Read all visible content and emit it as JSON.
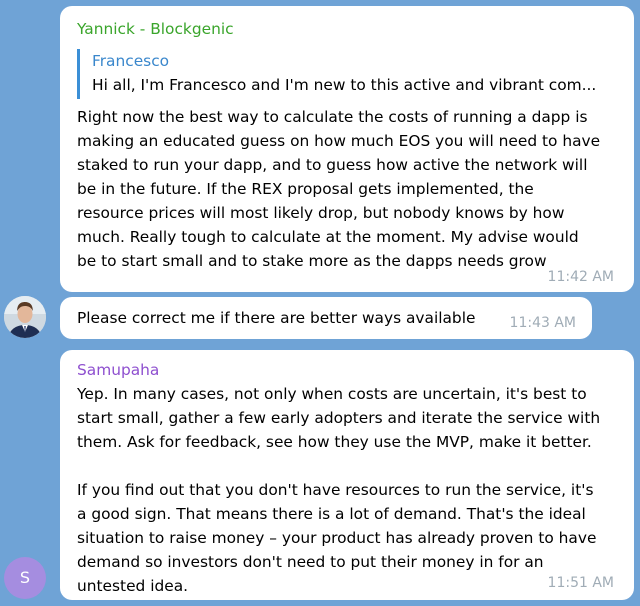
{
  "messages": [
    {
      "sender": "Yannick - Blockgenic",
      "sender_color": "#3aa52b",
      "reply": {
        "name": "Francesco",
        "text": "Hi all, I'm Francesco and I'm new to this active and vibrant com..."
      },
      "lines": [
        "Right now the best way to calculate the costs of running a dapp is",
        "making an educated guess on how much EOS you will need to have",
        "staked to run your dapp, and to guess how active the network will",
        "be in the future. If the REX proposal gets implemented, the",
        "resource prices will most likely drop, but nobody knows by how",
        "much. Really tough to calculate at the moment. My advise would",
        "be to start small and to stake more as the dapps needs grow"
      ],
      "time": "11:42 AM"
    },
    {
      "text": "Please correct me if there are better ways available",
      "time": "11:43 AM"
    },
    {
      "sender": "Samupaha",
      "sender_color": "#8e4fcf",
      "avatar_initial": "S",
      "avatar_color": "#a58de0",
      "lines": [
        "Yep. In many cases, not only when costs are uncertain, it's best to",
        "start small, gather a few early adopters and iterate the service with",
        "them. Ask for feedback, see how they use the MVP, make it better.",
        "",
        "If you find out that you don't have resources to run the service, it's",
        "a good sign. That means there is a lot of demand. That's the ideal",
        "situation to raise money – your product has already proven to have",
        "demand so investors don't need to put their money in for an",
        "untested idea."
      ],
      "time": "11:51 AM"
    }
  ]
}
